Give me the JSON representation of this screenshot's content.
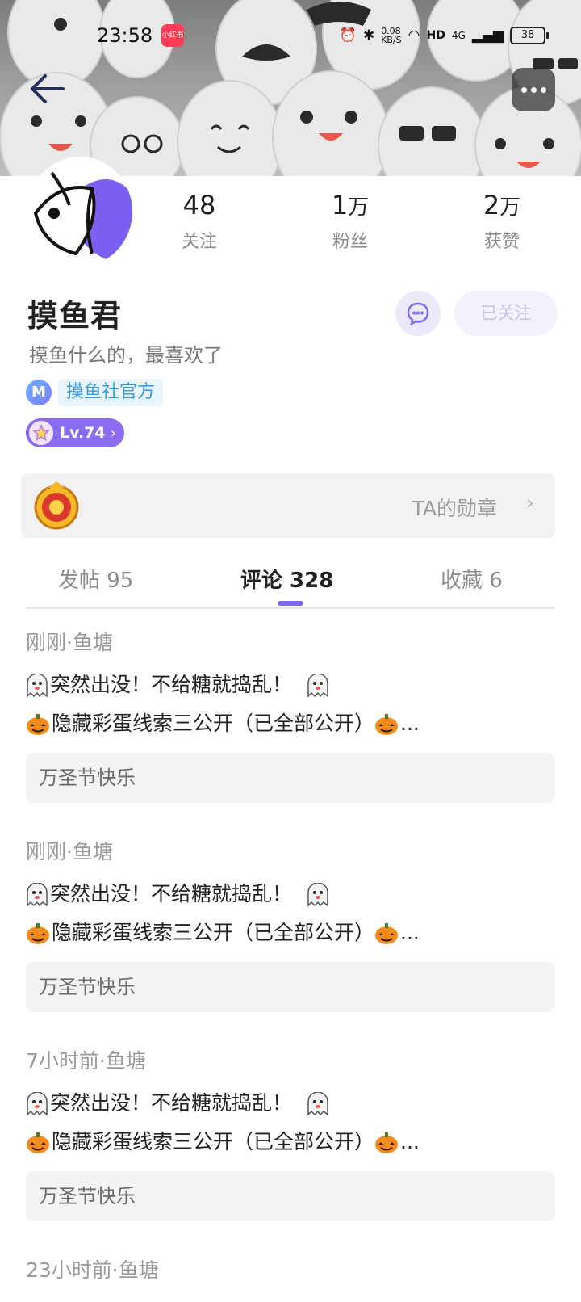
{
  "status_bar": {
    "time": "23:58",
    "app_badge": "小红书",
    "net_speed": "0.08\nKB/S",
    "hd": "HD",
    "signal": "4G",
    "battery": "38"
  },
  "profile": {
    "name": "摸鱼君",
    "bio": "摸鱼什么的，最喜欢了",
    "org_icon_letter": "M",
    "org_label": "摸鱼社官方",
    "level_label": "Lv.74",
    "follow_label": "已关注"
  },
  "stats": [
    {
      "num": "48",
      "unit": "",
      "label": "关注"
    },
    {
      "num": "1",
      "unit": "万",
      "label": "粉丝"
    },
    {
      "num": "2",
      "unit": "万",
      "label": "获赞"
    }
  ],
  "medal": {
    "label": "TA的勋章"
  },
  "tabs": [
    {
      "label": "发帖 95",
      "active": false
    },
    {
      "label": "评论 328",
      "active": true
    },
    {
      "label": "收藏 6",
      "active": false
    }
  ],
  "feed": [
    {
      "meta": "刚刚·鱼塘",
      "line1": "突然出没！不给糖就捣乱！",
      "line2": "隐藏彩蛋线索三公开（已全部公开）",
      "comment": "万圣节快乐"
    },
    {
      "meta": "刚刚·鱼塘",
      "line1": "突然出没！不给糖就捣乱！",
      "line2": "隐藏彩蛋线索三公开（已全部公开）",
      "comment": "万圣节快乐"
    },
    {
      "meta": "7小时前·鱼塘",
      "line1": "突然出没！不给糖就捣乱！",
      "line2": "隐藏彩蛋线索三公开（已全部公开）",
      "comment": "万圣节快乐"
    },
    {
      "meta": "23小时前·鱼塘"
    }
  ],
  "icons": [
    "back-arrow-icon",
    "more-icon",
    "chat-icon",
    "chevron-right-icon",
    "ghost-emoji-icon",
    "pumpkin-emoji-icon",
    "medal-icon"
  ],
  "colors": {
    "accent": "#7c6cf0",
    "level_bg": "#8a6cf0",
    "org_tag": "#3c9bd9"
  }
}
